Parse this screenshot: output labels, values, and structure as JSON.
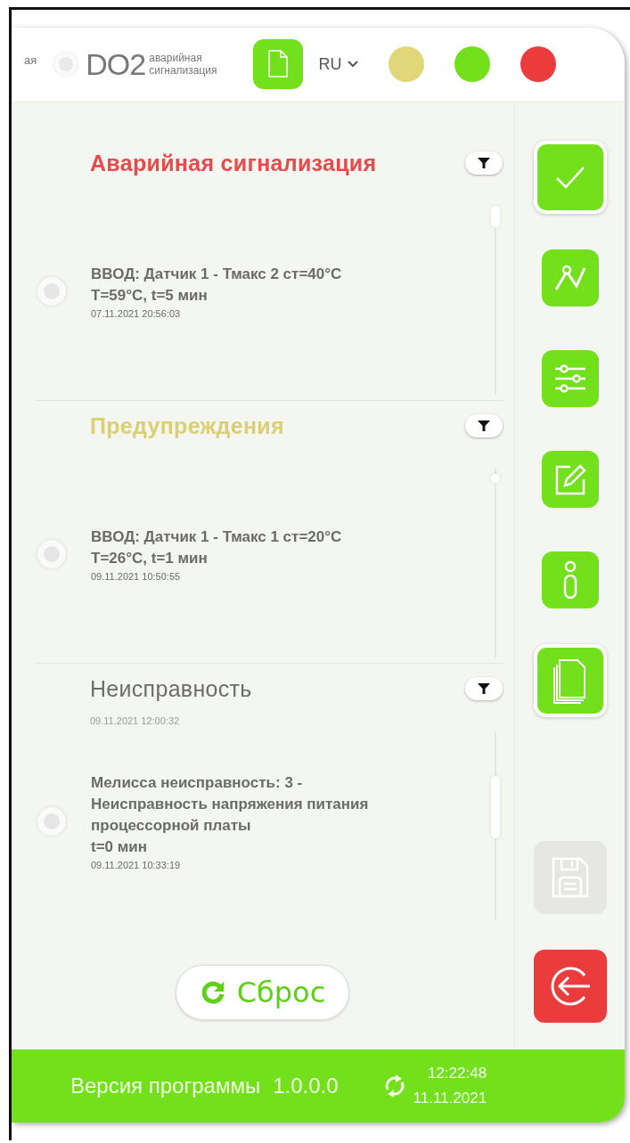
{
  "header": {
    "cut_label": "ая",
    "device": {
      "selected": false,
      "name": "DO2",
      "subtitle_lines": [
        "аварийная",
        "сигнализация"
      ]
    },
    "language": "RU",
    "status_dots": [
      {
        "color": "#e2d67a"
      },
      {
        "color": "#72e01a"
      },
      {
        "color": "#ea3c3c"
      }
    ]
  },
  "sections": [
    {
      "title": "Аварийная сигнализация",
      "kind": "alarm",
      "events": [
        {
          "clipped": false,
          "selected": false,
          "lines": [
            "ВВОД: Датчик 1 - Тмакс 2 ст=40°C",
            "T=59°C, t=5 мин"
          ],
          "date": "07.11.2021 20:56:03"
        }
      ]
    },
    {
      "title": "Предупреждения",
      "kind": "warning",
      "events": [
        {
          "clipped": false,
          "selected": false,
          "lines": [
            "ВВОД: Датчик 1 - Тмакс 1 ст=20°C",
            "T=26°C, t=1 мин"
          ],
          "date": "09.11.2021 10:50:55"
        }
      ]
    },
    {
      "title": "Неисправность",
      "kind": "fault",
      "events": [
        {
          "clipped": true,
          "date": "09.11.2021 12:00:32"
        },
        {
          "clipped": false,
          "selected": false,
          "lines": [
            "Мелисса неисправность: 3 -",
            "Неисправность напряжения питания",
            "процессорной платы",
            "t=0 мин"
          ],
          "date": "09.11.2021 10:33:19"
        }
      ]
    }
  ],
  "reset_button": "Сброс",
  "sidebar": [
    {
      "kind": "check",
      "selected": true,
      "disabled": false
    },
    {
      "kind": "chart",
      "selected": false,
      "disabled": false
    },
    {
      "kind": "sliders",
      "selected": false,
      "disabled": false
    },
    {
      "kind": "edit",
      "selected": false,
      "disabled": false
    },
    {
      "kind": "info",
      "selected": false,
      "disabled": false
    },
    {
      "kind": "documents",
      "selected": true,
      "disabled": false
    },
    {
      "kind": "save",
      "selected": false,
      "disabled": true
    },
    {
      "kind": "exit",
      "selected": false,
      "disabled": false
    }
  ],
  "footer": {
    "version_label": "Версия программы",
    "version": "1.0.0.0",
    "time": "12:22:48",
    "date": "11.11.2021"
  }
}
